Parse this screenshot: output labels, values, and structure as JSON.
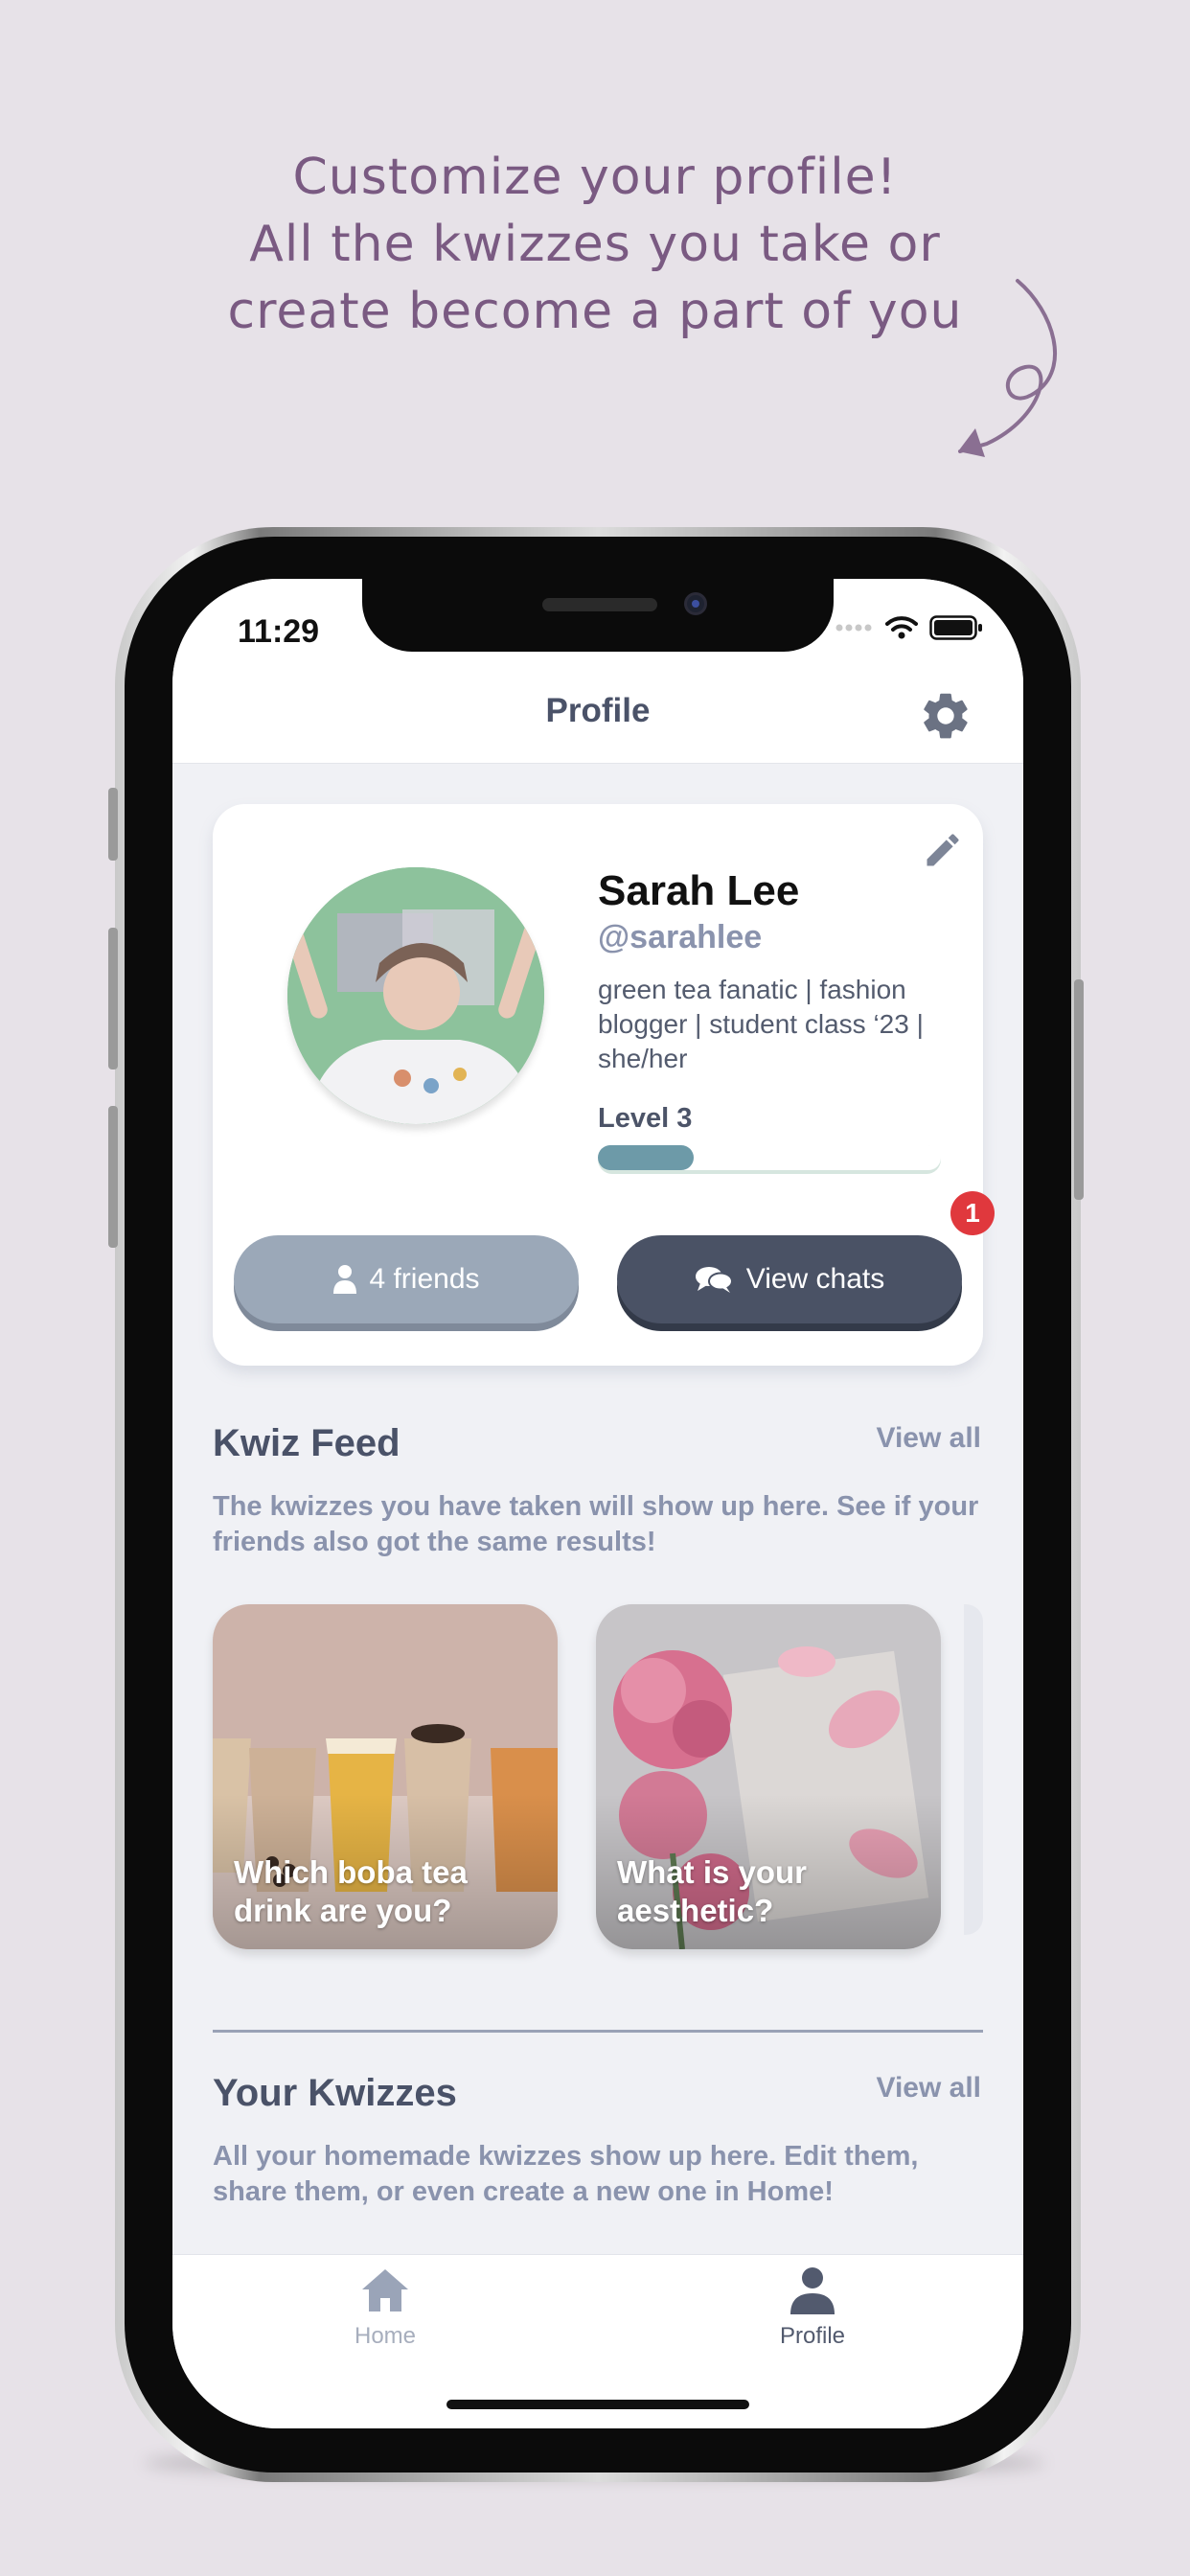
{
  "promo": {
    "line1": "Customize your profile!",
    "line2": "All the kwizzes you take or",
    "line3": "create become a part of you"
  },
  "status_bar": {
    "time": "11:29"
  },
  "nav": {
    "title": "Profile",
    "settings_icon": "gear-icon"
  },
  "profile": {
    "name": "Sarah Lee",
    "handle": "@sarahlee",
    "bio": "green tea fanatic | fashion blogger | student class ‘23 | she/her",
    "level_label": "Level 3",
    "level_progress": 0.28,
    "friends_label": "4 friends",
    "chats_label": "View chats",
    "chats_badge": "1"
  },
  "kwiz_feed": {
    "title": "Kwiz Feed",
    "view_all": "View all",
    "description": "The kwizzes you have taken will show up here. See if your friends also got the same results!",
    "items": [
      {
        "label": "Which boba tea drink are you?"
      },
      {
        "label": "What is your aesthetic?"
      }
    ]
  },
  "your_kwizzes": {
    "title": "Your Kwizzes",
    "view_all": "View all",
    "description": "All your homemade kwizzes show up here. Edit them, share them, or even create a new one in Home!"
  },
  "tabbar": {
    "home_label": "Home",
    "profile_label": "Profile",
    "active": "Profile"
  },
  "colors": {
    "background": "#e7e2e8",
    "promo_text": "#7a5a82",
    "title_text": "#4a5268",
    "muted_text": "#8a93ad",
    "friends_button": "#9ba8b8",
    "chats_button": "#4a5265",
    "badge": "#e0383d",
    "level_fill": "#6d9aa8"
  }
}
